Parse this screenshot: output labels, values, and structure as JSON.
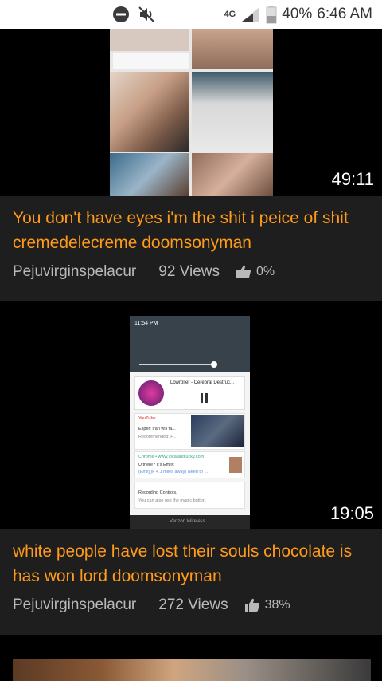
{
  "status_bar": {
    "network": "4G",
    "battery": "40%",
    "time": "6:46 AM",
    "icons": [
      "dnd-icon",
      "mute-icon",
      "signal-icon",
      "battery-icon"
    ]
  },
  "videos": [
    {
      "title": "You don't have eyes i'm the shit i peice of shit cremedelecreme doomsonyman",
      "author": "Pejuvirginspelacur",
      "views": "92 Views",
      "rating": "0%",
      "duration": "49:11"
    },
    {
      "title": "white people have lost their souls chocolate is has won lord doomsonyman",
      "author": "Pejuvirginspelacur",
      "views": "272 Views",
      "rating": "38%",
      "duration": "19:05",
      "thumb": {
        "clock": "11:54 PM",
        "player_title": "Lowroller - Cerebral Destruc...",
        "yt_source": "YouTube",
        "yt_headline": "Esper: Iran will fa...",
        "yt_sub": "Recommended: F...",
        "chrome_line": "Chrome • www.localandlucky.com",
        "chat_line": "U there? It's Emily.",
        "chat_sub": "(Emily)F 4.1 miles away) Need to ...",
        "rec_title": "Recording Controls.",
        "rec_sub": "You can also use the magic button.",
        "carrier": "Verizon Wireless"
      }
    }
  ],
  "colors": {
    "title": "#ff9a1a",
    "meta": "#b9b9b9",
    "card_bg": "#1e1e1e",
    "page_bg": "#000000"
  }
}
